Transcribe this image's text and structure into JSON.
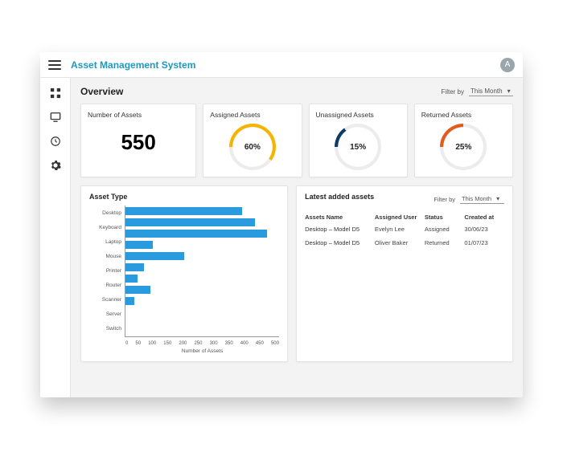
{
  "header": {
    "app_title": "Asset Management System",
    "avatar_initial": "A"
  },
  "page": {
    "title": "Overview",
    "filter_label": "Filter by",
    "filter_value": "This Month"
  },
  "kpis": [
    {
      "title": "Number of Assets",
      "value": "550"
    },
    {
      "title": "Assigned Assets",
      "percent": 60,
      "label": "60%",
      "color": "#f4b400"
    },
    {
      "title": "Unassigned Assets",
      "percent": 15,
      "label": "15%",
      "color": "#0d3a66"
    },
    {
      "title": "Returned Assets",
      "percent": 25,
      "label": "25%",
      "color": "#e25a1c"
    }
  ],
  "asset_type_panel": {
    "title": "Asset Type"
  },
  "chart_data": {
    "type": "bar",
    "orientation": "horizontal",
    "categories": [
      "Desktop",
      "Keyboard",
      "Laptop",
      "Mouse",
      "Printer",
      "Router",
      "Scanner",
      "Server",
      "Switch"
    ],
    "values": [
      380,
      420,
      460,
      90,
      190,
      60,
      40,
      80,
      30
    ],
    "xlabel": "Number of Assets",
    "ylabel": "",
    "xlim": [
      0,
      500
    ],
    "x_ticks": [
      0,
      50,
      100,
      150,
      200,
      250,
      300,
      350,
      400,
      450,
      500
    ],
    "title": "Asset Type"
  },
  "latest_panel": {
    "title": "Latest added assets",
    "filter_label": "Filter by",
    "filter_value": "This Month",
    "columns": [
      "Assets Name",
      "Assigned User",
      "Status",
      "Created at"
    ],
    "rows": [
      {
        "name": "Desktop – Model D5",
        "user": "Evelyn Lee",
        "status": "Assigned",
        "date": "30/06/23"
      },
      {
        "name": "Desktop – Model D5",
        "user": "Oliver Baker",
        "status": "Returned",
        "date": "01/07/23"
      }
    ]
  }
}
